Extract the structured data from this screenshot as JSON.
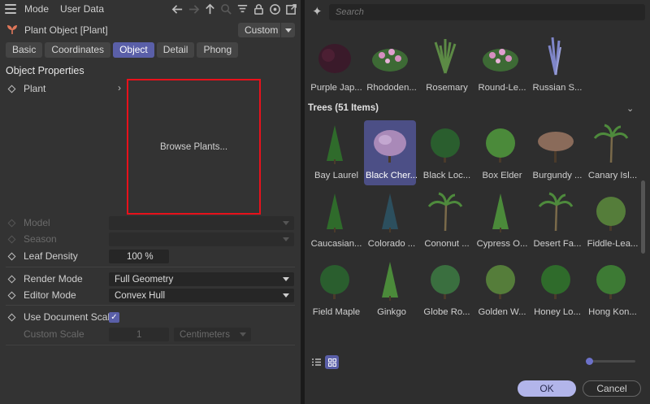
{
  "menubar": {
    "mode_label": "Mode",
    "userdata_label": "User Data"
  },
  "object": {
    "name": "Plant Object [Plant]",
    "preset": "Custom"
  },
  "tabs": [
    "Basic",
    "Coordinates",
    "Object",
    "Detail",
    "Phong"
  ],
  "active_tab": "Object",
  "section_title": "Object Properties",
  "properties": {
    "plant_label": "Plant",
    "browse_label": "Browse Plants...",
    "model_label": "Model",
    "season_label": "Season",
    "leaf_density_label": "Leaf Density",
    "leaf_density_value": "100 %",
    "render_mode_label": "Render Mode",
    "render_mode_value": "Full Geometry",
    "editor_mode_label": "Editor Mode",
    "editor_mode_value": "Convex Hull",
    "doc_scale_label": "Use Document Scale",
    "doc_scale_checked": true,
    "custom_scale_label": "Custom Scale",
    "custom_scale_value": "1",
    "custom_scale_unit": "Centimeters"
  },
  "browser": {
    "search_placeholder": "Search",
    "shrubs": [
      "Purple Jap...",
      "Rhododen...",
      "Rosemary",
      "Round-Le...",
      "Russian S..."
    ],
    "category_title": "Trees (51 Items)",
    "trees_row1": [
      "Bay Laurel",
      "Black Cher...",
      "Black Loc...",
      "Box Elder",
      "Burgundy ...",
      "Canary Isl..."
    ],
    "trees_row2": [
      "Caucasian...",
      "Colorado ...",
      "Cononut ...",
      "Cypress O...",
      "Desert Fa...",
      "Fiddle-Lea..."
    ],
    "trees_row3": [
      "Field Maple",
      "Ginkgo",
      "Globe Ro...",
      "Golden W...",
      "Honey Lo...",
      "Hong Kon..."
    ],
    "selected_item": "Black Cher...",
    "ok_label": "OK",
    "cancel_label": "Cancel"
  },
  "colors": {
    "accent": "#5a5fa8",
    "highlight_border": "#e8111b",
    "ok_button": "#b2b5ea"
  }
}
